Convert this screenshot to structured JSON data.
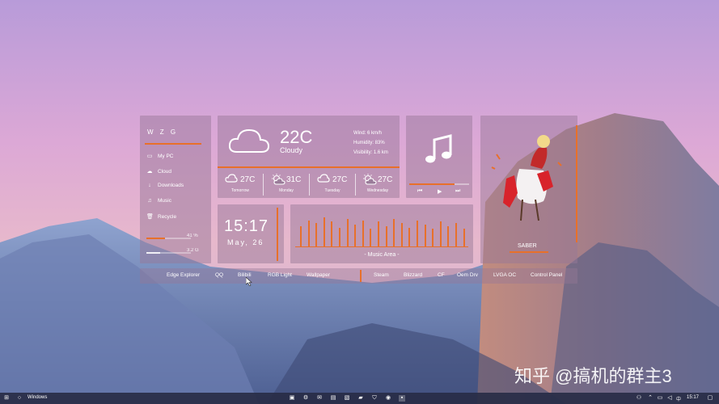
{
  "colors": {
    "accent": "#e8702a"
  },
  "sidebar": {
    "user": "W Z G",
    "items": [
      {
        "label": "My PC",
        "icon": "computer-icon"
      },
      {
        "label": "Cloud",
        "icon": "cloud-icon"
      },
      {
        "label": "Downloads",
        "icon": "download-icon"
      },
      {
        "label": "Music",
        "icon": "music-note-icon"
      },
      {
        "label": "Recycle",
        "icon": "recycle-bin-icon"
      }
    ],
    "stats": [
      {
        "label": "41 %",
        "level": 0.41
      },
      {
        "label": "3.2 G",
        "level": 0.3
      }
    ]
  },
  "weather": {
    "icon": "cloud-icon",
    "temp": "22C",
    "condition": "Cloudy",
    "wind": "Wind:     6 km/h",
    "humidity": "Humidity:    83%",
    "visibility": "Visibility:  1.6 km",
    "forecast": [
      {
        "day": "Tomorrow",
        "temp": "27C",
        "icon": "cloud-icon"
      },
      {
        "day": "Monday",
        "temp": "31C",
        "icon": "sun-cloud-icon"
      },
      {
        "day": "Tuesday",
        "temp": "27C",
        "icon": "cloud-icon"
      },
      {
        "day": "Wednesday",
        "temp": "27C",
        "icon": "sun-cloud-icon"
      }
    ]
  },
  "music": {
    "icon": "music-note-icon",
    "prev": "⏮",
    "play": "▶",
    "next": "⏭",
    "progress": 0.75
  },
  "character": {
    "name": "SABER"
  },
  "clock": {
    "time": "15:17",
    "date": "May, 26"
  },
  "visualizer": {
    "label": "- Music Area -",
    "levels": [
      0.7,
      0.9,
      0.8,
      1.0,
      0.85,
      0.65,
      0.95,
      0.75,
      0.9,
      0.6,
      0.85,
      0.7,
      0.95,
      0.8,
      0.65,
      0.9,
      0.75,
      0.6,
      0.85,
      0.7,
      0.8,
      0.6
    ]
  },
  "dock": {
    "left": [
      "Edge Explorer",
      "QQ",
      "Bilibili",
      "RGB Light",
      "Wallpaper"
    ],
    "right": [
      "Steam",
      "Blizzard",
      "CF",
      "Oem Drv",
      "LVGA OC",
      "Control Panel"
    ]
  },
  "taskbar": {
    "start_label": "Windows",
    "clock": "15:17",
    "lang": "中"
  },
  "watermark": "知乎 @搞机的群主3"
}
